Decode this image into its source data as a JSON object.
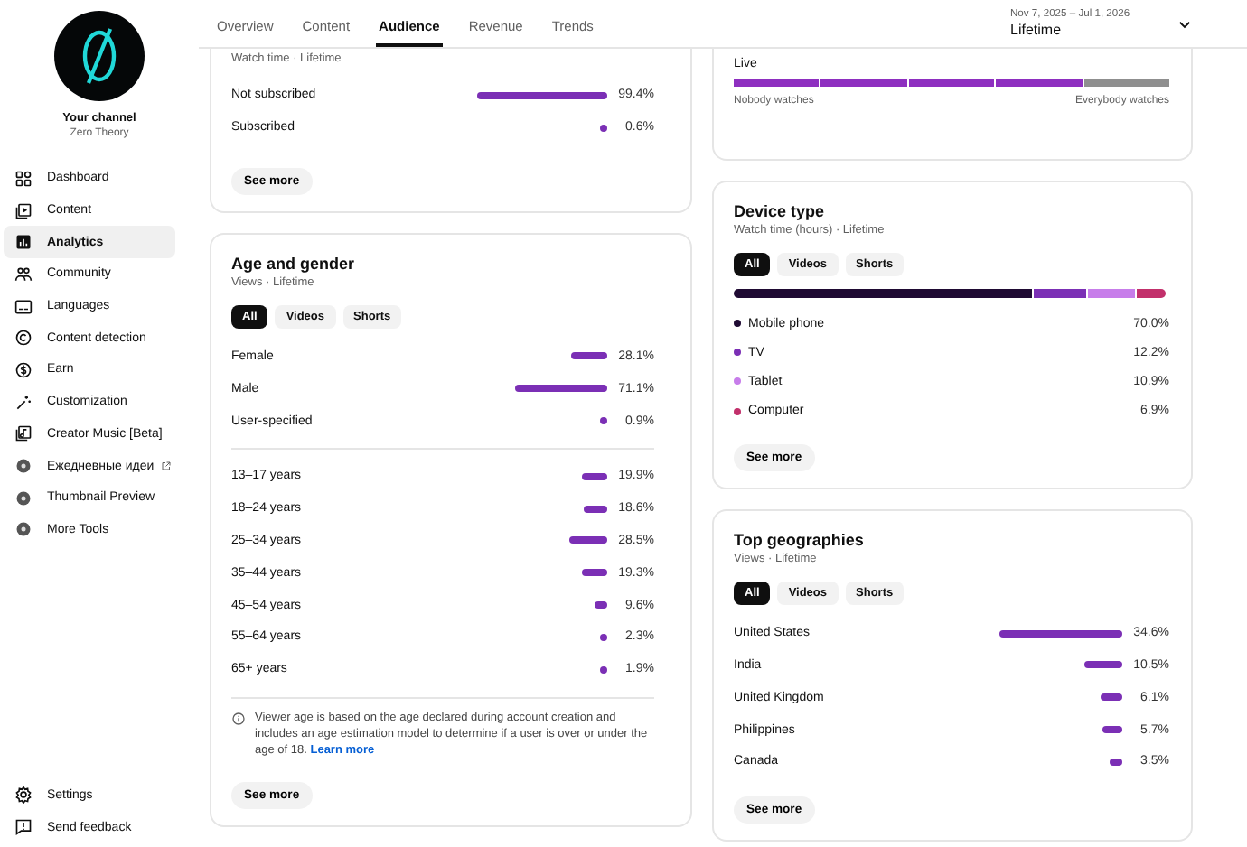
{
  "sidebar": {
    "channel_label": "Your channel",
    "channel_name": "Zero Theory",
    "items": [
      {
        "label": "Dashboard",
        "selected": false,
        "external": false
      },
      {
        "label": "Content",
        "selected": false,
        "external": false
      },
      {
        "label": "Analytics",
        "selected": true,
        "external": false
      },
      {
        "label": "Community",
        "selected": false,
        "external": false
      },
      {
        "label": "Languages",
        "selected": false,
        "external": false
      },
      {
        "label": "Content detection",
        "selected": false,
        "external": false
      },
      {
        "label": "Earn",
        "selected": false,
        "external": false
      },
      {
        "label": "Customization",
        "selected": false,
        "external": false
      },
      {
        "label": "Creator Music [Beta]",
        "selected": false,
        "external": false
      },
      {
        "label": "Ежедневные идеи",
        "selected": false,
        "external": true
      },
      {
        "label": "Thumbnail Preview",
        "selected": false,
        "external": false
      },
      {
        "label": "More Tools",
        "selected": false,
        "external": false
      }
    ],
    "footer_items": [
      {
        "label": "Settings"
      },
      {
        "label": "Send feedback"
      }
    ]
  },
  "tabs": [
    {
      "label": "Overview",
      "selected": false
    },
    {
      "label": "Content",
      "selected": false
    },
    {
      "label": "Audience",
      "selected": true
    },
    {
      "label": "Revenue",
      "selected": false
    },
    {
      "label": "Trends",
      "selected": false
    }
  ],
  "date_range": {
    "range": "Nov 7, 2025 – Jul 1, 2026",
    "preset": "Lifetime"
  },
  "left_column": [
    {
      "kind": "bars",
      "subtitle": "Watch time · Lifetime",
      "groups": [
        [
          {
            "label": "Not subscribed",
            "value": "99.4%"
          },
          {
            "label": "Subscribed",
            "value": "0.6%"
          }
        ]
      ],
      "button": "See more"
    },
    {
      "kind": "bars",
      "title": "Age and gender",
      "subtitle": "Views · Lifetime",
      "filters": [
        {
          "label": "All",
          "selected": true
        },
        {
          "label": "Videos",
          "selected": false
        },
        {
          "label": "Shorts",
          "selected": false
        }
      ],
      "groups": [
        [
          {
            "label": "Female",
            "value": "28.1%"
          },
          {
            "label": "Male",
            "value": "71.1%"
          },
          {
            "label": "User-specified",
            "value": "0.9%"
          }
        ],
        [
          {
            "label": "13–17 years",
            "value": "19.9%"
          },
          {
            "label": "18–24 years",
            "value": "18.6%"
          },
          {
            "label": "25–34 years",
            "value": "28.5%"
          },
          {
            "label": "35–44 years",
            "value": "19.3%"
          },
          {
            "label": "45–54 years",
            "value": "9.6%"
          },
          {
            "label": "55–64 years",
            "value": "2.3%"
          },
          {
            "label": "65+ years",
            "value": "1.9%"
          }
        ]
      ],
      "note": {
        "text": "Viewer age is based on the age declared during account creation and includes an age estimation model to determine if a user is over or under the age of 18.",
        "link": "Learn more"
      },
      "button": "See more"
    }
  ],
  "right_column": [
    {
      "kind": "live",
      "label": "Live",
      "level": 0.8,
      "start_label": "Nobody watches",
      "end_label": "Everybody watches"
    },
    {
      "kind": "device",
      "title": "Device type",
      "subtitle": "Watch time (hours) · Lifetime",
      "filters": [
        {
          "label": "All",
          "selected": true
        },
        {
          "label": "Videos",
          "selected": false
        },
        {
          "label": "Shorts",
          "selected": false
        }
      ],
      "segments": [
        {
          "label": "Mobile phone",
          "value": "70.0%",
          "color": "#1f0a33"
        },
        {
          "label": "TV",
          "value": "12.2%",
          "color": "#7b2fb5"
        },
        {
          "label": "Tablet",
          "value": "10.9%",
          "color": "#c77dea"
        },
        {
          "label": "Computer",
          "value": "6.9%",
          "color": "#c2306b"
        }
      ],
      "button": "See more"
    },
    {
      "kind": "bars",
      "title": "Top geographies",
      "subtitle": "Views · Lifetime",
      "filters": [
        {
          "label": "All",
          "selected": true
        },
        {
          "label": "Videos",
          "selected": false
        },
        {
          "label": "Shorts",
          "selected": false
        }
      ],
      "groups": [
        [
          {
            "label": "United States",
            "value": "34.6%"
          },
          {
            "label": "India",
            "value": "10.5%"
          },
          {
            "label": "United Kingdom",
            "value": "6.1%"
          },
          {
            "label": "Philippines",
            "value": "5.7%"
          },
          {
            "label": "Canada",
            "value": "3.5%"
          }
        ]
      ],
      "button": "See more"
    }
  ]
}
